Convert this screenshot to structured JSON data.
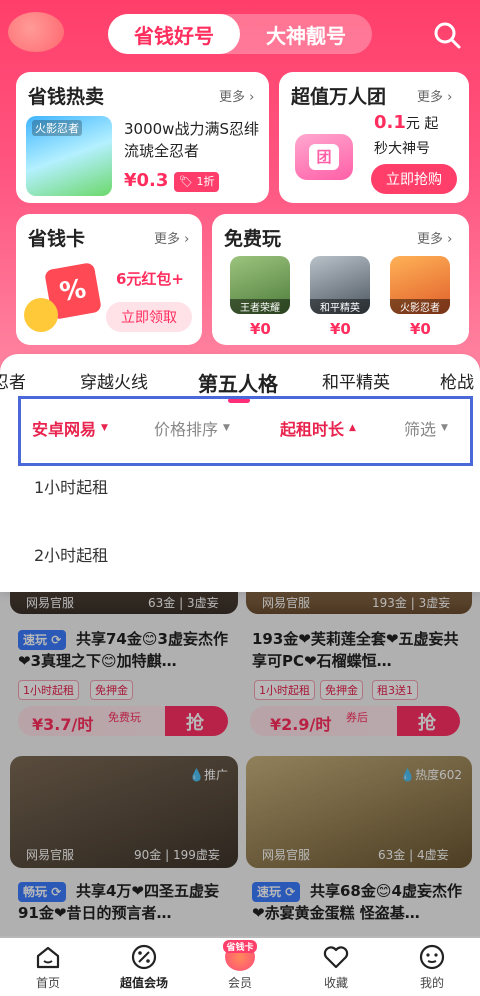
{
  "header": {
    "tabs": [
      {
        "label": "省钱好号",
        "active": true
      },
      {
        "label": "大神靓号",
        "active": false
      }
    ]
  },
  "cards": {
    "hot": {
      "title": "省钱热卖",
      "more": "更多",
      "game_label": "火影忍者",
      "desc": "3000w战力满S忍绯流琥全忍者",
      "price": "¥0.3",
      "discount": "1折"
    },
    "group": {
      "title": "超值万人团",
      "more": "更多",
      "price": "0.1",
      "price_unit": "元 起",
      "desc": "秒大神号",
      "button": "立即抢购",
      "icon_text": "团"
    },
    "saver": {
      "title": "省钱卡",
      "more": "更多",
      "text": "6元红包+",
      "button": "立即领取"
    },
    "free": {
      "title": "免费玩",
      "more": "更多",
      "games": [
        {
          "name": "王者荣耀",
          "price": "¥0"
        },
        {
          "name": "和平精英",
          "price": "¥0"
        },
        {
          "name": "火影忍者",
          "price": "¥0"
        }
      ]
    }
  },
  "game_tabs": [
    "忍者",
    "穿越火线",
    "第五人格",
    "和平精英",
    "枪战"
  ],
  "filters": [
    {
      "label": "安卓网易",
      "style": "red",
      "arrow": "▼"
    },
    {
      "label": "价格排序",
      "style": "gray",
      "arrow": "▼"
    },
    {
      "label": "起租时长",
      "style": "red",
      "arrow": "▲"
    },
    {
      "label": "筛选",
      "style": "gray",
      "arrow": "▼"
    }
  ],
  "dropdown_options": [
    "1小时起租",
    "2小时起租"
  ],
  "listings": [
    {
      "source": "网易官服",
      "gold": "63金",
      "tier": "3虚妄",
      "badge": "速玩",
      "title": "共享74金😊3虚妄杰作❤3真理之下😊加特麒…",
      "tags": [
        "1小时起租",
        "免押金"
      ],
      "price": "¥3.7/时",
      "note": "免费玩",
      "grab": "抢"
    },
    {
      "source": "网易官服",
      "gold": "193金",
      "tier": "3虚妄",
      "badge": "",
      "title": "193金❤芙莉莲全套❤五虚妄共享可PC❤石榴蝶恒…",
      "tags": [
        "1小时起租",
        "免押金",
        "租3送1"
      ],
      "price": "¥2.9/时",
      "note": "券后",
      "grab": "抢"
    },
    {
      "source": "网易官服",
      "gold": "90金",
      "tier": "199虚妄",
      "badge": "畅玩",
      "title": "共享4万❤四圣五虚妄91金❤昔日的预言者…",
      "corner": "推广"
    },
    {
      "source": "网易官服",
      "gold": "63金",
      "tier": "4虚妄",
      "badge": "速玩",
      "title": "共享68金😊4虚妄杰作❤赤宴黄金蛋糕 怪盗基…",
      "corner": "热度602"
    }
  ],
  "bottom_nav": [
    {
      "label": "首页"
    },
    {
      "label": "超值会场",
      "active": true
    },
    {
      "label": "会员",
      "badge": "省钱卡"
    },
    {
      "label": "收藏"
    },
    {
      "label": "我的"
    }
  ],
  "colors": {
    "accent": "#ff2e5e",
    "filter_box": "#4a68d8"
  }
}
